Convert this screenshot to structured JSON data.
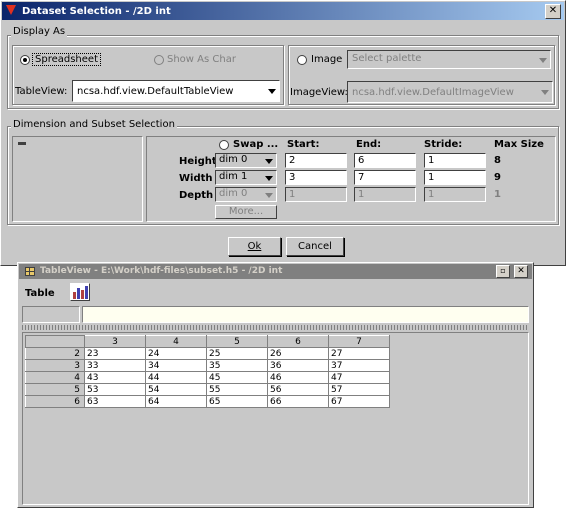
{
  "dialog": {
    "title": "Dataset Selection - /2D int",
    "display_as": {
      "group_label": "Display As",
      "spreadsheet_label": "Spreadsheet",
      "show_as_char_label": "Show As Char",
      "image_label": "Image",
      "palette_placeholder": "Select palette",
      "tableview_label": "TableView:",
      "tableview_value": "ncsa.hdf.view.DefaultTableView",
      "imageview_label": "ImageView:",
      "imageview_value": "ncsa.hdf.view.DefaultImageView"
    },
    "subset": {
      "group_label": "Dimension and Subset Selection",
      "swap_label": "Swap ...",
      "headers": {
        "start": "Start:",
        "end": "End:",
        "stride": "Stride:",
        "max": "Max Size"
      },
      "rows": [
        {
          "label": "Height",
          "dim": "dim 0",
          "start": "2",
          "end": "6",
          "stride": "1",
          "max": "8"
        },
        {
          "label": "Width",
          "dim": "dim 1",
          "start": "3",
          "end": "7",
          "stride": "1",
          "max": "9"
        },
        {
          "label": "Depth",
          "dim": "dim 0",
          "start": "1",
          "end": "1",
          "stride": "1",
          "max": "1"
        }
      ],
      "more_label": "More..."
    },
    "ok_label": "Ok",
    "cancel_label": "Cancel"
  },
  "tableview": {
    "title": "TableView - E:\\Work\\hdf-files\\subset.h5 - /2D int",
    "menu_table": "Table",
    "chart_icon": "chart-icon",
    "column_headers": [
      "3",
      "4",
      "5",
      "6",
      "7"
    ],
    "rows": [
      {
        "label": "2",
        "cells": [
          "23",
          "24",
          "25",
          "26",
          "27"
        ]
      },
      {
        "label": "3",
        "cells": [
          "33",
          "34",
          "35",
          "36",
          "37"
        ]
      },
      {
        "label": "4",
        "cells": [
          "43",
          "44",
          "45",
          "46",
          "47"
        ]
      },
      {
        "label": "5",
        "cells": [
          "53",
          "54",
          "55",
          "56",
          "57"
        ]
      },
      {
        "label": "6",
        "cells": [
          "63",
          "64",
          "65",
          "66",
          "67"
        ]
      }
    ]
  },
  "colors": {
    "title_active": "#0a246a",
    "title_inactive": "#808080",
    "panel": "#c8c8c8",
    "desktop": "#ffffff"
  }
}
